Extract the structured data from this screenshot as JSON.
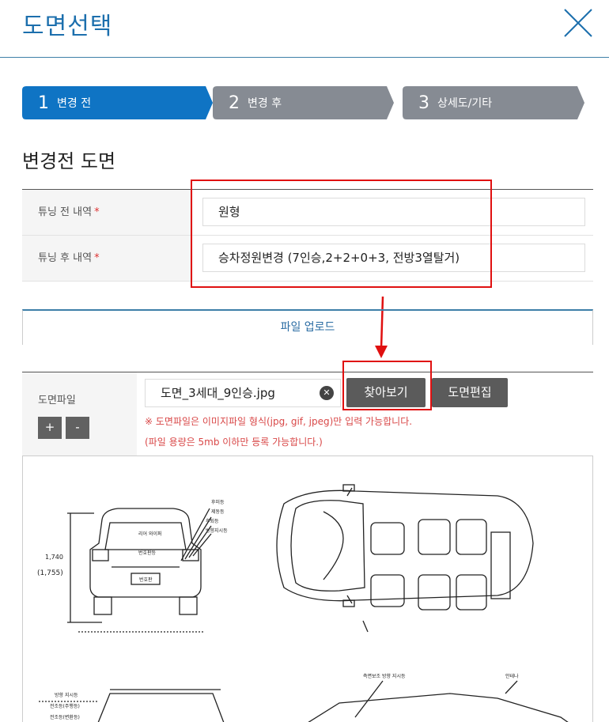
{
  "header": {
    "title": "도면선택"
  },
  "steps": [
    {
      "num": "1",
      "label": "변경 전",
      "active": true
    },
    {
      "num": "2",
      "label": "변경 후",
      "active": false
    },
    {
      "num": "3",
      "label": "상세도/기타",
      "active": false
    }
  ],
  "colors": {
    "active_step": "#0f74c4",
    "inactive_step": "#868b93",
    "accent": "#1c6fad",
    "highlight": "#e01010",
    "notice": "#d94848"
  },
  "section": {
    "title": "변경전 도면"
  },
  "form": {
    "before_label": "튜닝 전 내역",
    "before_value": "원형",
    "after_label": "튜닝 후 내역",
    "after_value": "승차정원변경 (7인승,2+2+0+3, 전방3열탈거)",
    "required_mark": "*"
  },
  "upload": {
    "tab_label": "파일 업로드",
    "file_label": "도면파일",
    "plus": "+",
    "minus": "-",
    "file_name": "도면_3세대_9인승.jpg",
    "clear_glyph": "✕",
    "browse_button": "찾아보기",
    "edit_button": "도면편집",
    "notice1": "※ 도면파일은 이미지파일 형식(jpg, gif, jpeg)만 입력 가능합니다.",
    "notice2": "(파일 용량은 5mb 이하만 등록 가능합니다.)"
  },
  "drawing": {
    "label_height": "1,740",
    "label_height_paren": "(1,755)",
    "label_rear_wiper": "리어 와이퍼",
    "label_plate_lamp": "번호판등",
    "label_rear_lamp": "후미등",
    "label_brake": "제동등",
    "label_reverse": "후퇴등",
    "label_turn": "방향지시등",
    "label_plate": "번호판",
    "label_side_turn": "측면보조 방향 지시등",
    "label_antenna": "안테나",
    "label_front_turn": "방향 지시등",
    "label_headlamp": "전조등(주행등)",
    "label_headlamp2": "전조등(변환등)"
  }
}
